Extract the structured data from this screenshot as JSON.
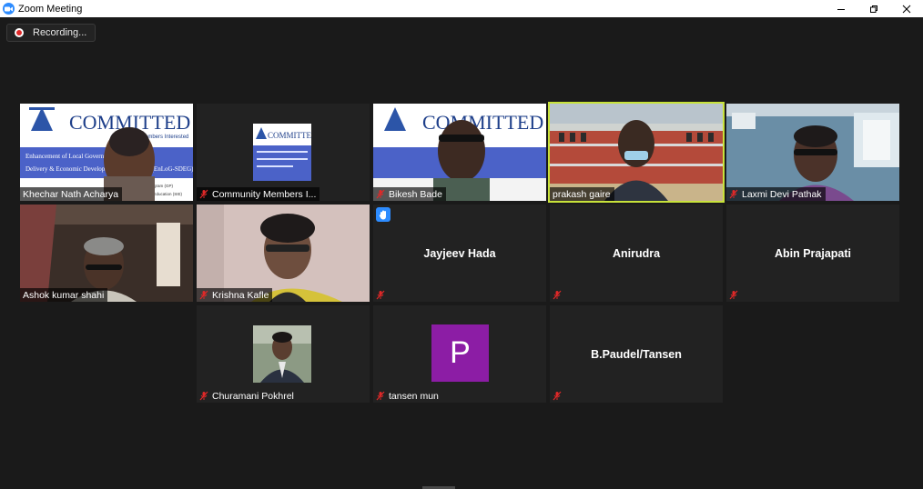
{
  "window": {
    "title": "Zoom Meeting"
  },
  "recording": {
    "label": "Recording..."
  },
  "participants": {
    "khechar": "Khechar Nath Acharya",
    "community": "Community Members I...",
    "bikesh": "Bikesh Bade",
    "prakash": "prakash gaire",
    "laxmi": "Laxmi Devi Pathak",
    "ashok": "Ashok kumar shahi",
    "krishna": "Krishna Kafle",
    "jayjeev": "Jayjeev Hada",
    "anirudra": "Anirudra",
    "abin": "Abin Prajapati",
    "churamani": "Churamani Pokhrel",
    "tansen_mun": "tansen mun",
    "tansen_mun_avatar": "P",
    "bpaudel": "B.Paudel/Tansen"
  },
  "slide": {
    "logo_text": "COMMITTED",
    "tagline": "Community Members Interested",
    "line1": "Enhancement of Local Governments, Service",
    "line2": "Delivery & Economic Development Governance (EnLoG-SDEG)",
    "program": "Program (GP)",
    "footer": "for Education (SIE)"
  },
  "colors": {
    "active_border": "#c8e23a",
    "accent": "#2d8cff",
    "avatar_purple": "#8c1da5",
    "muted_red": "#e02828"
  }
}
